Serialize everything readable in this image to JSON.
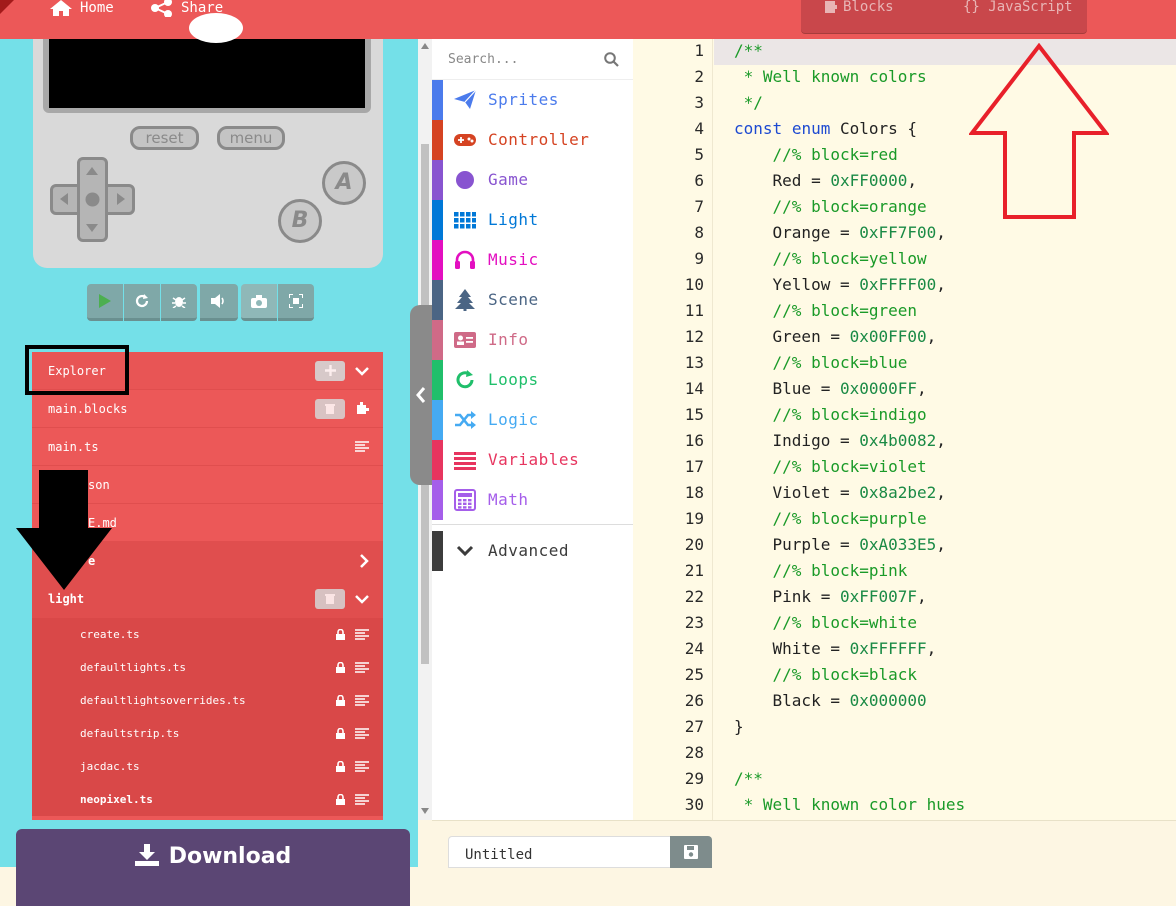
{
  "topbar": {
    "home_label": "Home",
    "share_label": "Share",
    "blocks_label": "Blocks",
    "javascript_label": "{} JavaScript"
  },
  "simulator": {
    "reset_label": "reset",
    "menu_label": "menu",
    "a_label": "A",
    "b_label": "B"
  },
  "explorer": {
    "title": "Explorer",
    "rows": [
      {
        "label": "main.blocks"
      },
      {
        "label": "main.ts"
      },
      {
        "label": "pxt.json"
      },
      {
        "label": "README.md"
      },
      {
        "label": "game"
      },
      {
        "label": "light"
      }
    ],
    "visible_partials": {
      "pxt": "son",
      "readme": "E.md",
      "game": "e"
    },
    "light_files": [
      "create.ts",
      "defaultlights.ts",
      "defaultlightsoverrides.ts",
      "defaultstrip.ts",
      "jacdac.ts",
      "neopixel.ts"
    ]
  },
  "download_label": "Download",
  "search": {
    "placeholder": "Search..."
  },
  "toolbox": [
    {
      "label": "Sprites",
      "color": "#4b7bec",
      "icon": "paper-plane-icon"
    },
    {
      "label": "Controller",
      "color": "#d54322",
      "icon": "gamepad-icon"
    },
    {
      "label": "Game",
      "color": "#8854d0",
      "icon": "circle-icon"
    },
    {
      "label": "Light",
      "color": "#0078d7",
      "icon": "grid-icon"
    },
    {
      "label": "Music",
      "color": "#e30fc0",
      "icon": "headphones-icon"
    },
    {
      "label": "Scene",
      "color": "#4b6584",
      "icon": "tree-icon"
    },
    {
      "label": "Info",
      "color": "#cf6a87",
      "icon": "id-card-icon"
    },
    {
      "label": "Loops",
      "color": "#20bf6b",
      "icon": "refresh-icon"
    },
    {
      "label": "Logic",
      "color": "#45aaf2",
      "icon": "shuffle-icon"
    },
    {
      "label": "Variables",
      "color": "#e7355f",
      "icon": "list-icon"
    },
    {
      "label": "Math",
      "color": "#a55eea",
      "icon": "calculator-icon"
    }
  ],
  "advanced_label": "Advanced",
  "code": {
    "line_numbers": [
      "1",
      "2",
      "3",
      "4",
      "5",
      "6",
      "7",
      "8",
      "9",
      "10",
      "11",
      "12",
      "13",
      "14",
      "15",
      "16",
      "17",
      "18",
      "19",
      "20",
      "21",
      "22",
      "23",
      "24",
      "25",
      "26",
      "27",
      "28",
      "29",
      "30"
    ],
    "lines": [
      [
        {
          "c": "/**",
          "s": "c"
        }
      ],
      [
        {
          "c": " * Well known colors",
          "s": "c"
        }
      ],
      [
        {
          "c": " */",
          "s": "c"
        }
      ],
      [
        {
          "c": "const",
          "s": "k"
        },
        {
          "c": " ",
          "s": "t"
        },
        {
          "c": "enum",
          "s": "k"
        },
        {
          "c": " Colors {",
          "s": "t"
        }
      ],
      [
        {
          "c": "    //% block=red",
          "s": "c"
        }
      ],
      [
        {
          "c": "    Red = ",
          "s": "t"
        },
        {
          "c": "0xFF0000",
          "s": "n"
        },
        {
          "c": ",",
          "s": "t"
        }
      ],
      [
        {
          "c": "    //% block=orange",
          "s": "c"
        }
      ],
      [
        {
          "c": "    Orange = ",
          "s": "t"
        },
        {
          "c": "0xFF7F00",
          "s": "n"
        },
        {
          "c": ",",
          "s": "t"
        }
      ],
      [
        {
          "c": "    //% block=yellow",
          "s": "c"
        }
      ],
      [
        {
          "c": "    Yellow = ",
          "s": "t"
        },
        {
          "c": "0xFFFF00",
          "s": "n"
        },
        {
          "c": ",",
          "s": "t"
        }
      ],
      [
        {
          "c": "    //% block=green",
          "s": "c"
        }
      ],
      [
        {
          "c": "    Green = ",
          "s": "t"
        },
        {
          "c": "0x00FF00",
          "s": "n"
        },
        {
          "c": ",",
          "s": "t"
        }
      ],
      [
        {
          "c": "    //% block=blue",
          "s": "c"
        }
      ],
      [
        {
          "c": "    Blue = ",
          "s": "t"
        },
        {
          "c": "0x0000FF",
          "s": "n"
        },
        {
          "c": ",",
          "s": "t"
        }
      ],
      [
        {
          "c": "    //% block=indigo",
          "s": "c"
        }
      ],
      [
        {
          "c": "    Indigo = ",
          "s": "t"
        },
        {
          "c": "0x4b0082",
          "s": "n"
        },
        {
          "c": ",",
          "s": "t"
        }
      ],
      [
        {
          "c": "    //% block=violet",
          "s": "c"
        }
      ],
      [
        {
          "c": "    Violet = ",
          "s": "t"
        },
        {
          "c": "0x8a2be2",
          "s": "n"
        },
        {
          "c": ",",
          "s": "t"
        }
      ],
      [
        {
          "c": "    //% block=purple",
          "s": "c"
        }
      ],
      [
        {
          "c": "    Purple = ",
          "s": "t"
        },
        {
          "c": "0xA033E5",
          "s": "n"
        },
        {
          "c": ",",
          "s": "t"
        }
      ],
      [
        {
          "c": "    //% block=pink",
          "s": "c"
        }
      ],
      [
        {
          "c": "    Pink = ",
          "s": "t"
        },
        {
          "c": "0xFF007F",
          "s": "n"
        },
        {
          "c": ",",
          "s": "t"
        }
      ],
      [
        {
          "c": "    //% block=white",
          "s": "c"
        }
      ],
      [
        {
          "c": "    White = ",
          "s": "t"
        },
        {
          "c": "0xFFFFFF",
          "s": "n"
        },
        {
          "c": ",",
          "s": "t"
        }
      ],
      [
        {
          "c": "    //% block=black",
          "s": "c"
        }
      ],
      [
        {
          "c": "    Black = ",
          "s": "t"
        },
        {
          "c": "0x000000",
          "s": "n"
        }
      ],
      [
        {
          "c": "}",
          "s": "t"
        }
      ],
      [],
      [
        {
          "c": "/**",
          "s": "c"
        }
      ],
      [
        {
          "c": " * Well known color hues",
          "s": "c"
        }
      ]
    ]
  },
  "filename": {
    "value": "Untitled"
  },
  "colors": {
    "topbar": "#ec5858",
    "simulator_bg": "#74e0e8",
    "explorer_bg": "#ec5858",
    "download_bg": "#5b4674",
    "editor_bg": "#fffae5",
    "annotation_red": "#e8202a",
    "annotation_black": "#000000"
  }
}
